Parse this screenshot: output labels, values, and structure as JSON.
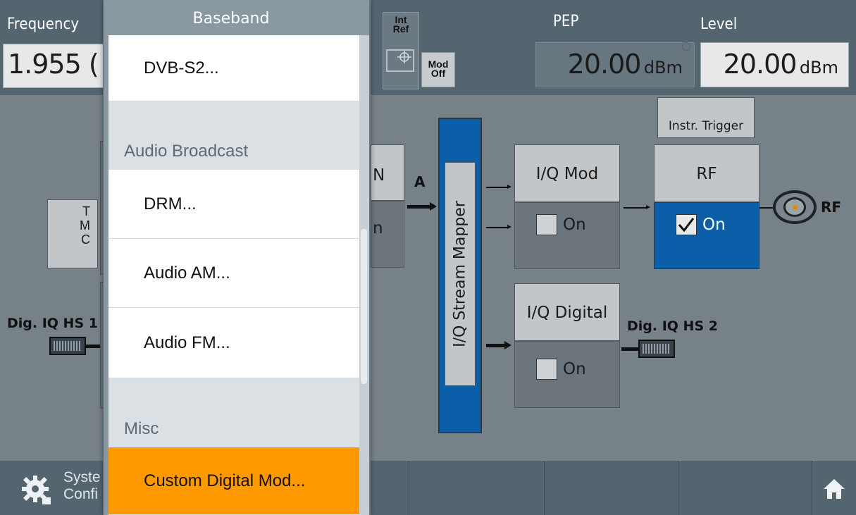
{
  "header": {
    "frequency_label": "Frequency",
    "frequency_value": "1.955 (",
    "int_ref_line1": "Int",
    "int_ref_line2": "Ref",
    "mod_off_line1": "Mod",
    "mod_off_line2": "Off",
    "pep_label": "PEP",
    "pep_value": "20.00",
    "pep_unit": "dBm",
    "level_label": "Level",
    "level_value": "20.00",
    "level_unit": "dBm"
  },
  "diagram": {
    "tmc_letters": [
      "T",
      "M",
      "C"
    ],
    "dig_iq_hs1": "Dig. IQ HS 1",
    "partial_block_letter": "N",
    "partial_block_letter2": "n",
    "path_a": "A",
    "stream_mapper": "I/Q Stream Mapper",
    "iq_mod": {
      "title": "I/Q Mod",
      "state": "On",
      "checked": false
    },
    "rf": {
      "title": "RF",
      "state": "On",
      "checked": true
    },
    "instr_trigger": "Instr. Trigger",
    "rf_output_label": "RF",
    "iq_digital": {
      "title": "I/Q Digital",
      "state": "On",
      "checked": false
    },
    "dig_iq_hs2": "Dig. IQ HS 2"
  },
  "bottom_bar": {
    "system_config_line1": "Syste",
    "system_config_line2": "Confi"
  },
  "menu": {
    "title": "Baseband",
    "items": [
      {
        "type": "item",
        "label": "DVB-S2..."
      },
      {
        "type": "section",
        "label": "Audio Broadcast"
      },
      {
        "type": "item",
        "label": "DRM..."
      },
      {
        "type": "item",
        "label": "Audio AM..."
      },
      {
        "type": "item",
        "label": "Audio FM..."
      },
      {
        "type": "section",
        "label": "Misc"
      },
      {
        "type": "item",
        "label": "Custom Digital Mod...",
        "selected": true
      }
    ]
  },
  "colors": {
    "accent_blue": "#0a5fa8",
    "selected_orange": "#ff9900",
    "panel_bg": "#778188",
    "bar_bg": "#556570"
  }
}
